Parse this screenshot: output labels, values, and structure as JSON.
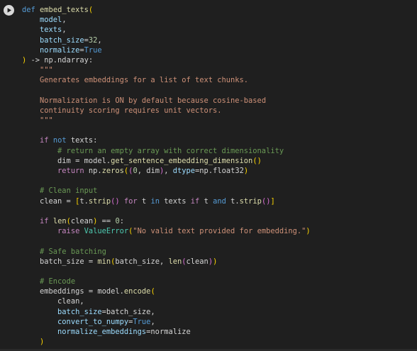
{
  "cell": {
    "run_button": {
      "icon": "play-icon"
    },
    "code_lines": [
      [
        {
          "t": "def",
          "c": "kw"
        },
        {
          "t": " "
        },
        {
          "t": "embed_texts",
          "c": "fn"
        },
        {
          "t": "(",
          "c": "b1"
        }
      ],
      [
        {
          "t": "    "
        },
        {
          "t": "model",
          "c": "pm"
        },
        {
          "t": ","
        }
      ],
      [
        {
          "t": "    "
        },
        {
          "t": "texts",
          "c": "pm"
        },
        {
          "t": ","
        }
      ],
      [
        {
          "t": "    "
        },
        {
          "t": "batch_size",
          "c": "pm"
        },
        {
          "t": "="
        },
        {
          "t": "32",
          "c": "num"
        },
        {
          "t": ","
        }
      ],
      [
        {
          "t": "    "
        },
        {
          "t": "normalize",
          "c": "pm"
        },
        {
          "t": "="
        },
        {
          "t": "True",
          "c": "kw"
        }
      ],
      [
        {
          "t": ")",
          "c": "b1"
        },
        {
          "t": " -> np.ndarray:"
        }
      ],
      [
        {
          "t": "    "
        },
        {
          "t": "\"\"\"",
          "c": "str"
        }
      ],
      [
        {
          "t": "    "
        },
        {
          "t": "Generates embeddings for a list of text chunks.",
          "c": "str"
        }
      ],
      [],
      [
        {
          "t": "    "
        },
        {
          "t": "Normalization is ON by default because cosine-based",
          "c": "str"
        }
      ],
      [
        {
          "t": "    "
        },
        {
          "t": "continuity scoring requires unit vectors.",
          "c": "str"
        }
      ],
      [
        {
          "t": "    "
        },
        {
          "t": "\"\"\"",
          "c": "str"
        }
      ],
      [],
      [
        {
          "t": "    "
        },
        {
          "t": "if",
          "c": "kc"
        },
        {
          "t": " "
        },
        {
          "t": "not",
          "c": "kw"
        },
        {
          "t": " texts:"
        }
      ],
      [
        {
          "t": "        "
        },
        {
          "t": "# return an empty array with correct dimensionality",
          "c": "com"
        }
      ],
      [
        {
          "t": "        dim = model."
        },
        {
          "t": "get_sentence_embedding_dimension",
          "c": "fn"
        },
        {
          "t": "()",
          "c": "b1"
        }
      ],
      [
        {
          "t": "        "
        },
        {
          "t": "return",
          "c": "kc"
        },
        {
          "t": " np."
        },
        {
          "t": "zeros",
          "c": "fn"
        },
        {
          "t": "(",
          "c": "b1"
        },
        {
          "t": "(",
          "c": "b2"
        },
        {
          "t": "0",
          "c": "num"
        },
        {
          "t": ", dim"
        },
        {
          "t": ")",
          "c": "b2"
        },
        {
          "t": ", "
        },
        {
          "t": "dtype",
          "c": "pm"
        },
        {
          "t": "=np.float32"
        },
        {
          "t": ")",
          "c": "b1"
        }
      ],
      [],
      [
        {
          "t": "    "
        },
        {
          "t": "# Clean input",
          "c": "com"
        }
      ],
      [
        {
          "t": "    clean = "
        },
        {
          "t": "[",
          "c": "b1"
        },
        {
          "t": "t."
        },
        {
          "t": "strip",
          "c": "fn"
        },
        {
          "t": "()",
          "c": "b2"
        },
        {
          "t": " "
        },
        {
          "t": "for",
          "c": "kc"
        },
        {
          "t": " t "
        },
        {
          "t": "in",
          "c": "kw"
        },
        {
          "t": " texts "
        },
        {
          "t": "if",
          "c": "kc"
        },
        {
          "t": " t "
        },
        {
          "t": "and",
          "c": "kw"
        },
        {
          "t": " t."
        },
        {
          "t": "strip",
          "c": "fn"
        },
        {
          "t": "()",
          "c": "b2"
        },
        {
          "t": "]",
          "c": "b1"
        }
      ],
      [],
      [
        {
          "t": "    "
        },
        {
          "t": "if",
          "c": "kc"
        },
        {
          "t": " "
        },
        {
          "t": "len",
          "c": "fn"
        },
        {
          "t": "(",
          "c": "b1"
        },
        {
          "t": "clean"
        },
        {
          "t": ")",
          "c": "b1"
        },
        {
          "t": " == "
        },
        {
          "t": "0",
          "c": "num"
        },
        {
          "t": ":"
        }
      ],
      [
        {
          "t": "        "
        },
        {
          "t": "raise",
          "c": "kc"
        },
        {
          "t": " "
        },
        {
          "t": "ValueError",
          "c": "cls"
        },
        {
          "t": "(",
          "c": "b1"
        },
        {
          "t": "\"No valid text provided for embedding.\"",
          "c": "str"
        },
        {
          "t": ")",
          "c": "b1"
        }
      ],
      [],
      [
        {
          "t": "    "
        },
        {
          "t": "# Safe batching",
          "c": "com"
        }
      ],
      [
        {
          "t": "    batch_size = "
        },
        {
          "t": "min",
          "c": "fn"
        },
        {
          "t": "(",
          "c": "b1"
        },
        {
          "t": "batch_size, "
        },
        {
          "t": "len",
          "c": "fn"
        },
        {
          "t": "(",
          "c": "b2"
        },
        {
          "t": "clean"
        },
        {
          "t": ")",
          "c": "b2"
        },
        {
          "t": ")",
          "c": "b1"
        }
      ],
      [],
      [
        {
          "t": "    "
        },
        {
          "t": "# Encode",
          "c": "com"
        }
      ],
      [
        {
          "t": "    embeddings = model."
        },
        {
          "t": "encode",
          "c": "fn"
        },
        {
          "t": "(",
          "c": "b1"
        }
      ],
      [
        {
          "t": "        clean,"
        }
      ],
      [
        {
          "t": "        "
        },
        {
          "t": "batch_size",
          "c": "pm"
        },
        {
          "t": "=batch_size,"
        }
      ],
      [
        {
          "t": "        "
        },
        {
          "t": "convert_to_numpy",
          "c": "pm"
        },
        {
          "t": "="
        },
        {
          "t": "True",
          "c": "kw"
        },
        {
          "t": ","
        }
      ],
      [
        {
          "t": "        "
        },
        {
          "t": "normalize_embeddings",
          "c": "pm"
        },
        {
          "t": "=normalize"
        }
      ],
      [
        {
          "t": "    "
        },
        {
          "t": ")",
          "c": "b1"
        }
      ]
    ]
  }
}
